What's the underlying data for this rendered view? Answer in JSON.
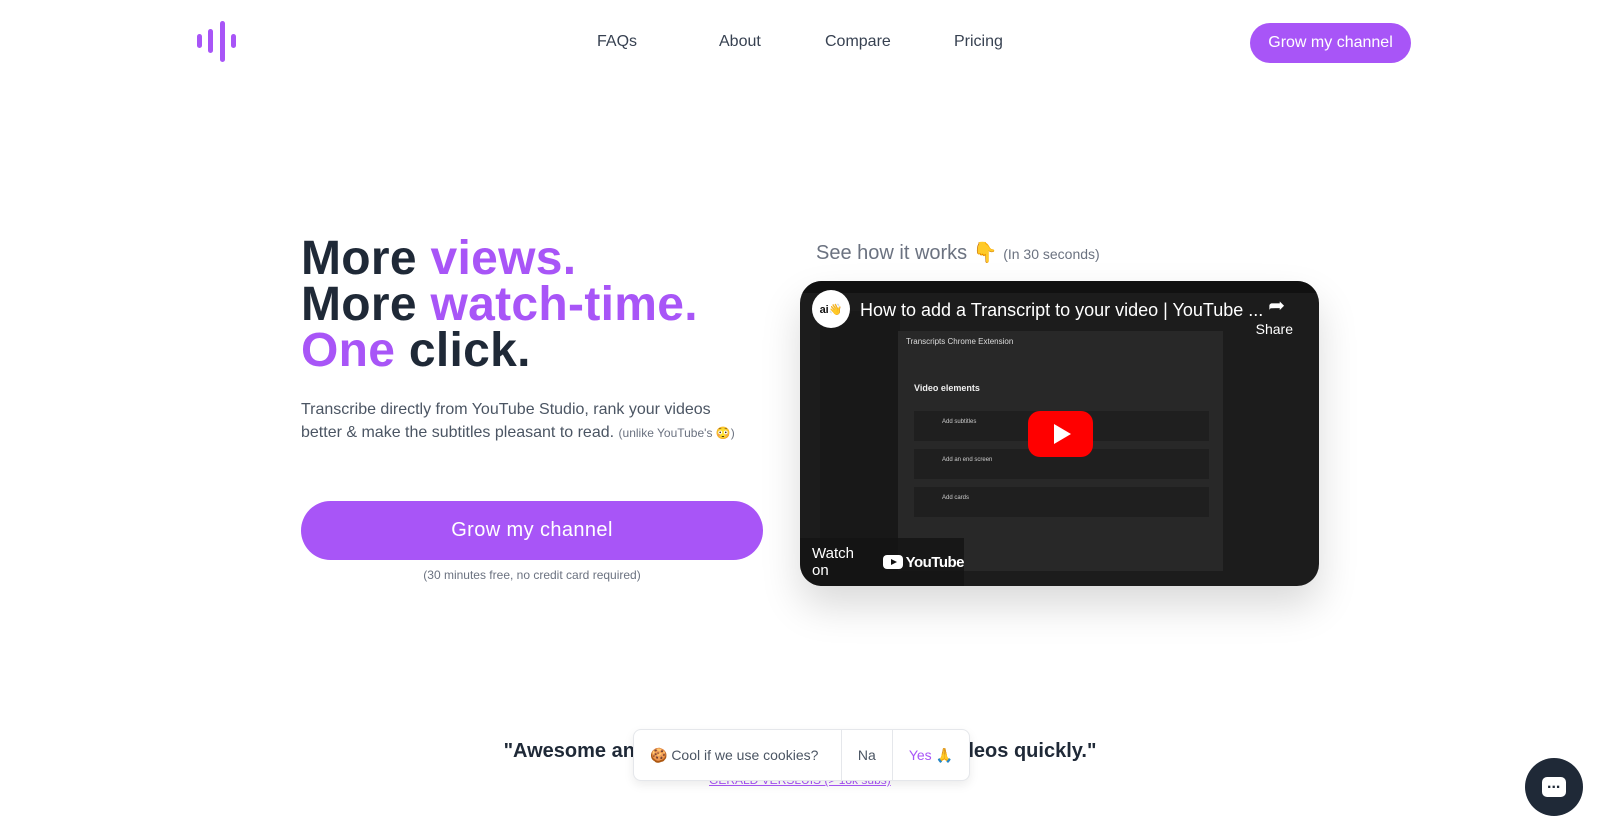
{
  "nav": {
    "items": [
      "FAQs",
      "About",
      "Compare",
      "Pricing"
    ],
    "cta": "Grow my channel"
  },
  "hero": {
    "line1a": "More ",
    "line1b": "views.",
    "line2a": "More ",
    "line2b": "watch-time.",
    "line3a": "One",
    "line3b": " click.",
    "subtitle": "Transcribe directly from YouTube Studio, rank your videos better & make the subtitles pleasant to read.",
    "aside": "(unlike YouTube's 😳)",
    "cta": "Grow my channel",
    "note": "(30 minutes free, no credit card required)"
  },
  "video": {
    "heading": "See how it works 👇",
    "duration": "(In 30 seconds)",
    "channel": "ai👋",
    "title": "How to add a Transcript to your video | YouTube ...",
    "share": "Share",
    "watch_on": "Watch on",
    "youtube": "YouTube",
    "dialog_title": "Transcripts Chrome Extension",
    "section": "Video elements",
    "rows": [
      "Add subtitles",
      "Add an end screen",
      "Add cards"
    ]
  },
  "testimonial": {
    "quote": "\"Awesome and easy way to add transcripts to videos quickly.\"",
    "author": "GERALD VERSLUIS (> 18k subs)"
  },
  "cookie": {
    "message": "🍪 Cool if we use cookies?",
    "no": "Na",
    "yes": "Yes 🙏"
  },
  "colors": {
    "accent": "#a855f7",
    "text": "#1f2937"
  }
}
